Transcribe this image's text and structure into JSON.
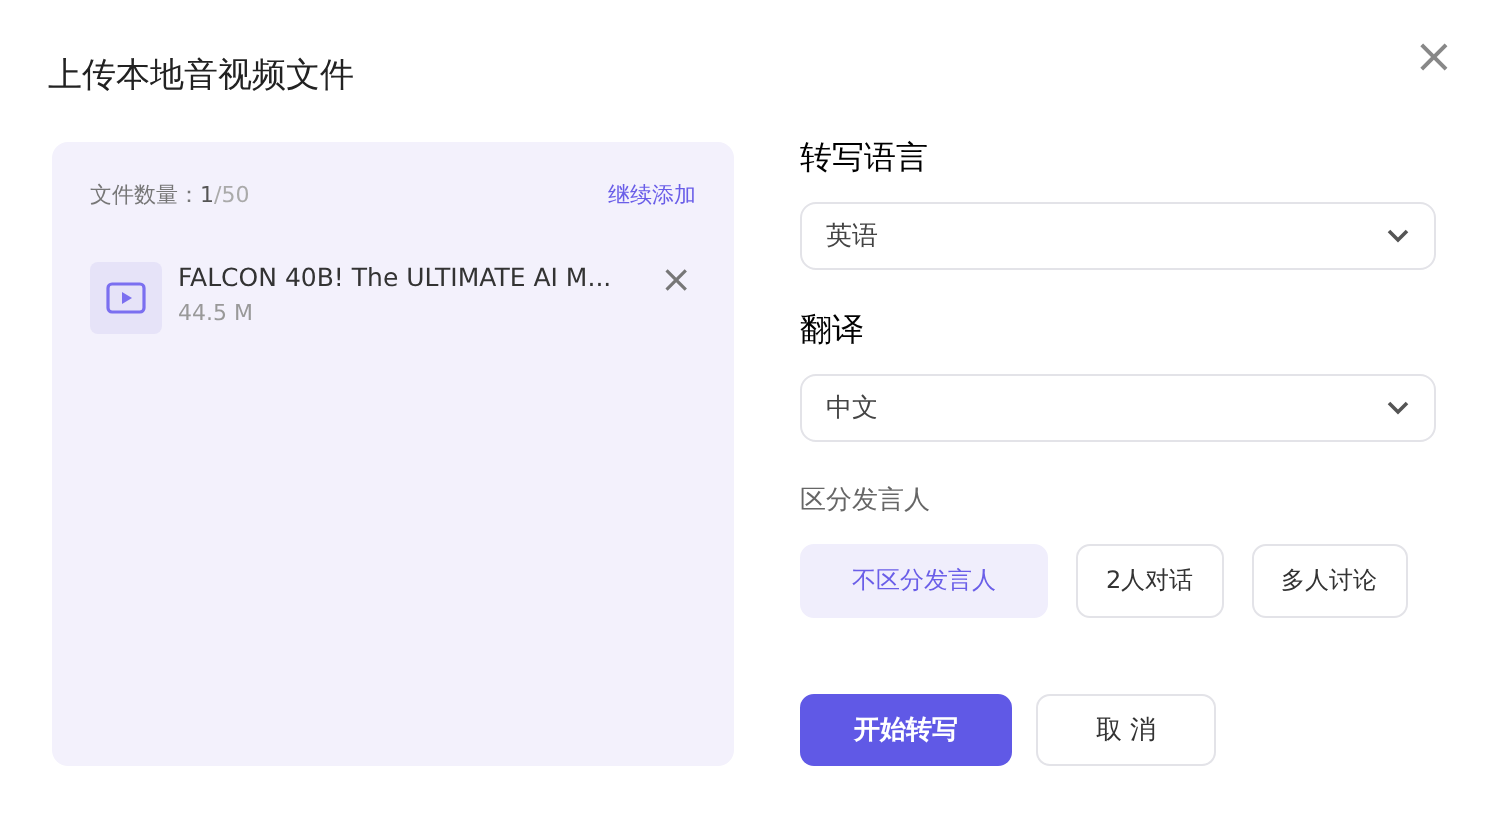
{
  "dialog": {
    "title": "上传本地音视频文件",
    "close": "×"
  },
  "file_panel": {
    "count_label": "文件数量：",
    "count": "1",
    "total": "/50",
    "add_link": "继续添加",
    "files": [
      {
        "name": "FALCON 40B! The ULTIMATE AI M...",
        "size": "44.5 M",
        "remove": "×"
      }
    ]
  },
  "transcribe_language": {
    "label": "转写语言",
    "value": "英语"
  },
  "translation": {
    "label": "翻译",
    "value": "中文"
  },
  "speakers": {
    "label": "区分发言人",
    "options": [
      {
        "label": "不区分发言人",
        "selected": true
      },
      {
        "label": "2人对话",
        "selected": false
      },
      {
        "label": "多人讨论",
        "selected": false
      }
    ]
  },
  "buttons": [
    {
      "label": "开始转写",
      "kind": "primary"
    },
    {
      "label": "取 消",
      "kind": "secondary"
    }
  ]
}
